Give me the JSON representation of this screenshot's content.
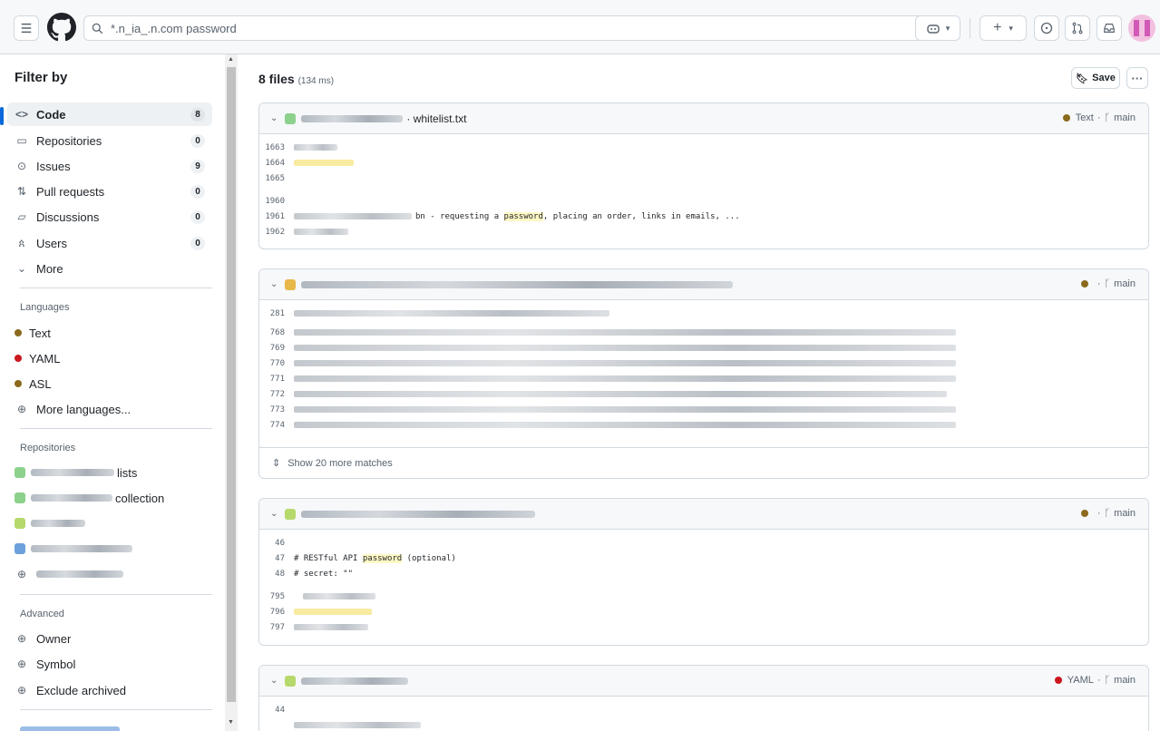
{
  "search": {
    "query": "*.n_ia_.n.com password"
  },
  "sidebar": {
    "title": "Filter by",
    "nav": [
      {
        "label": "Code",
        "count": "8"
      },
      {
        "label": "Repositories",
        "count": "0"
      },
      {
        "label": "Issues",
        "count": "9"
      },
      {
        "label": "Pull requests",
        "count": "0"
      },
      {
        "label": "Discussions",
        "count": "0"
      },
      {
        "label": "Users",
        "count": "0"
      },
      {
        "label": "More"
      }
    ],
    "languages_title": "Languages",
    "languages": [
      {
        "label": "Text",
        "color": "#8b6a1e"
      },
      {
        "label": "YAML",
        "color": "#cb171e"
      },
      {
        "label": "ASL",
        "color": "#8b6a1e"
      }
    ],
    "more_languages": "More languages...",
    "repositories_title": "Repositories",
    "repositories": [
      {
        "label": "lists"
      },
      {
        "label": "collection"
      },
      {
        "label": ""
      },
      {
        "label": ""
      },
      {
        "label": ""
      }
    ],
    "advanced_title": "Advanced",
    "advanced": [
      "Owner",
      "Symbol",
      "Exclude archived"
    ]
  },
  "results": {
    "count_label": "8 files",
    "time_label": "(134 ms)",
    "save_label": "Save",
    "cards": [
      {
        "file": "· whitelist.txt",
        "language": "Text",
        "lang_color": "#8b6a1e",
        "branch": "main",
        "lines": [
          {
            "n": "1663"
          },
          {
            "n": "1664"
          },
          {
            "n": "1665"
          },
          {
            "n": "1960"
          },
          {
            "n": "1961",
            "text_pre": "bn - requesting a ",
            "highlight": "password",
            "text_post": ", placing an order, links in emails, ..."
          },
          {
            "n": "1962"
          }
        ]
      },
      {
        "language": "",
        "lang_color": "#8b6a1e",
        "branch": "main",
        "lines": [
          {
            "n": "281"
          },
          {
            "n": "768"
          },
          {
            "n": "769"
          },
          {
            "n": "770"
          },
          {
            "n": "771"
          },
          {
            "n": "772"
          },
          {
            "n": "773"
          },
          {
            "n": "774"
          }
        ],
        "show_more": "Show 20 more matches"
      },
      {
        "language": "",
        "lang_color": "#8b6a1e",
        "branch": "main",
        "lines": [
          {
            "n": "46",
            "text": ""
          },
          {
            "n": "47",
            "text_pre": "# RESTful API ",
            "highlight": "password",
            "text_post": " (optional)"
          },
          {
            "n": "48",
            "text": "# secret: \"\""
          },
          {
            "n": "795"
          },
          {
            "n": "796"
          },
          {
            "n": "797"
          }
        ]
      },
      {
        "language": "YAML",
        "lang_color": "#cb171e",
        "branch": "main",
        "lines": [
          {
            "n": "44"
          }
        ]
      }
    ]
  }
}
